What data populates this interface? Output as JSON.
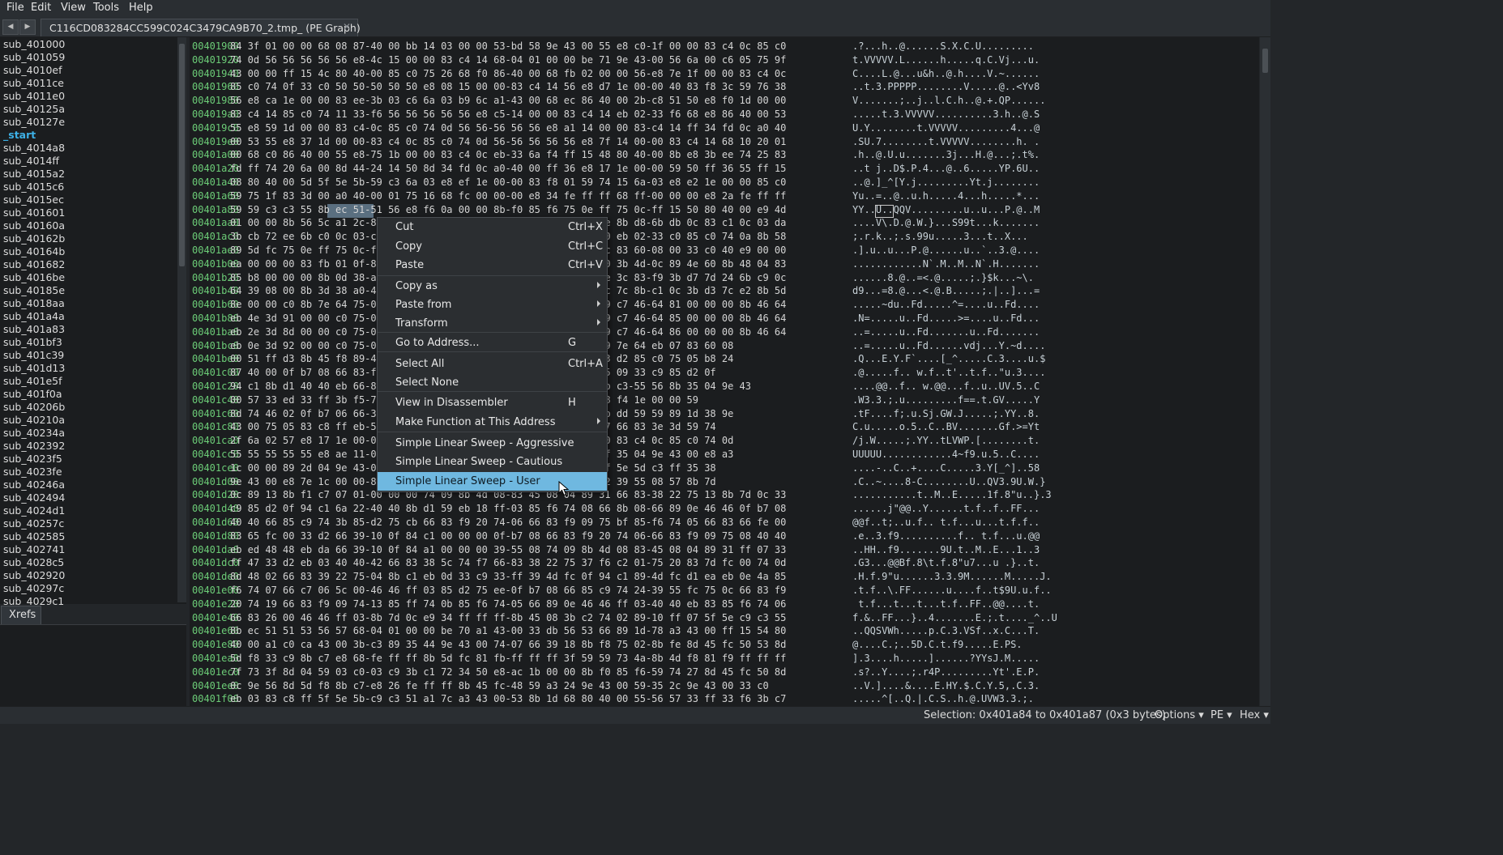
{
  "menubar": [
    "File",
    "Edit",
    "View",
    "Tools",
    "Help"
  ],
  "tab": {
    "title": "C116CD083284CC599C024C3479CA9B70_2.tmp_ (PE Graph)",
    "close": "✕"
  },
  "functions": [
    "sub_401000",
    "sub_401059",
    "sub_4010ef",
    "sub_4011ce",
    "sub_4011e0",
    "sub_40125a",
    "sub_40127e",
    "_start",
    "sub_4014a8",
    "sub_4014ff",
    "sub_4015a2",
    "sub_4015c6",
    "sub_4015ec",
    "sub_401601",
    "sub_40160a",
    "sub_40162b",
    "sub_40164b",
    "sub_401682",
    "sub_4016be",
    "sub_40185e",
    "sub_4018aa",
    "sub_401a4a",
    "sub_401a83",
    "sub_401bf3",
    "sub_401c39",
    "sub_401d13",
    "sub_401e5f",
    "sub_401f0a",
    "sub_40206b",
    "sub_40210a",
    "sub_40234a",
    "sub_402392",
    "sub_4023f5",
    "sub_4023fe",
    "sub_40246a",
    "sub_402494",
    "sub_4024d1",
    "sub_40257c",
    "sub_402585",
    "sub_402741",
    "sub_4028c5",
    "sub_402920",
    "sub_40297c",
    "sub_4029c1"
  ],
  "selected_function": "_start",
  "xrefs_tab": "Xrefs",
  "hex_rows": [
    {
      "addr": "00401900",
      "bytes": "84 3f 01 00 00 68 08 87-40 00 bb 14 03 00 00 53-bd 58 9e 43 00 55 e8 c0-1f 00 00 83 c4 0c 85 c0",
      "ascii": ".?...h..@......S.X.C.U........."
    },
    {
      "addr": "00401920",
      "bytes": "74 0d 56 56 56 56 56 e8-4c 15 00 00 83 c4 14 68-04 01 00 00 be 71 9e 43-00 56 6a 00 c6 05 75 9f",
      "ascii": "t.VVVVV.L......h.....q.C.Vj...u."
    },
    {
      "addr": "00401940",
      "bytes": "43 00 00 ff 15 4c 80 40-00 85 c0 75 26 68 f0 86-40 00 68 fb 02 00 00 56-e8 7e 1f 00 00 83 c4 0c",
      "ascii": "C....L.@...u&h..@.h....V.~......"
    },
    {
      "addr": "00401960",
      "bytes": "85 c0 74 0f 33 c0 50 50-50 50 50 e8 08 15 00 00-83 c4 14 56 e8 d7 1e 00-00 40 83 f8 3c 59 76 38",
      "ascii": "..t.3.PPPPP........V.....@..<Yv8"
    },
    {
      "addr": "00401980",
      "bytes": "56 e8 ca 1e 00 00 83 ee-3b 03 c6 6a 03 b9 6c a1-43 00 68 ec 86 40 00 2b-c8 51 50 e8 f0 1d 00 00",
      "ascii": "V.......;..j..l.C.h..@.+.QP......"
    },
    {
      "addr": "004019a0",
      "bytes": "83 c4 14 85 c0 74 11 33-f6 56 56 56 56 56 e8 c5-14 00 00 83 c4 14 eb 02-33 f6 68 e8 86 40 00 53",
      "ascii": ".....t.3.VVVVV..........3.h..@.S"
    },
    {
      "addr": "004019c0",
      "bytes": "55 e8 59 1d 00 00 83 c4-0c 85 c0 74 0d 56 56-56 56 56 e8 a1 14 00 00 83-c4 14 ff 34 fd 0c a0 40",
      "ascii": "U.Y........t.VVVVV.........4...@"
    },
    {
      "addr": "004019e0",
      "bytes": "00 53 55 e8 37 1d 00 00-83 c4 0c 85 c0 74 0d 56-56 56 56 56 e8 7f 14 00-00 83 c4 14 68 10 20 01",
      "ascii": ".SU.7........t.VVVVV........h. ."
    },
    {
      "addr": "00401a00",
      "bytes": "00 68 c0 86 40 00 55 e8-75 1b 00 00 83 c4 0c eb-33 6a f4 ff 15 48 80 40-00 8b e8 3b ee 74 25 83",
      "ascii": ".h..@.U.u.......3j...H.@...;.t%."
    },
    {
      "addr": "00401a20",
      "bytes": "fd ff 74 20 6a 00 8d 44-24 14 50 8d 34 fd 0c a0-40 00 ff 36 e8 17 1e 00-00 59 50 ff 36 55 ff 15",
      "ascii": "..t j..D$.P.4...@..6.....YP.6U.."
    },
    {
      "addr": "00401a40",
      "bytes": "08 80 40 00 5d 5f 5e 5b-59 c3 6a 03 e8 ef 1e 00-00 83 f8 01 59 74 15 6a-03 e8 e2 1e 00 00 85 c0",
      "ascii": "..@.]_^[Y.j.........Yt.j........"
    },
    {
      "addr": "00401a60",
      "bytes": "59 75 1f 83 3d 00 a0 40-00 01 75 16 68 fc 00 00-00 e8 34 fe ff ff 68 ff-00 00 00 e8 2a fe ff ff",
      "ascii": "Yu..=..@..u.h.....4...h.....*..."
    },
    {
      "addr": "00401a80",
      "bytes": "59 59 c3 c3 55 8b ec 51-51 56 e8 f6 0a 00 00 8b-f0 85 f6 75 0e ff 75 0c-ff 15 50 80 40 00 e9 4d",
      "ascii": "YY..U..QQV.........u..u...P.@..M"
    },
    {
      "addr": "00401aa0",
      "bytes": "01 00 00 8b 56 5c a1 2c-80 40 00 8b ce 39 01 74-0e 8b d8 39 74 0e 8b d8-6b db 0c 83 c1 0c 03 da",
      "ascii": "....V\\.D.@.W.}...S99t...k......."
    },
    {
      "addr": "00401ac0",
      "bytes": "3b cb 72 ee 6b c0 0c 03-c1 3b c8 73 39 39 75 00-00 75 01 00 75 00 eb 02-33 c0 85 c0 74 0a 8b 58",
      "ascii": ";.r.k..;.s.99u.....3...t..X..."
    },
    {
      "addr": "00401ae0",
      "bytes": "89 5d fc 75 0e ff 75 0c-ff 15 50 80 40 00 ff 75-0c 83 fb 05 75 0c 83 60-08 00 33 c0 40 e9 00 00",
      "ascii": ".].u..u...P.@......u..`..3.@...."
    },
    {
      "addr": "00401b00",
      "bytes": "ea 00 00 00 83 fb 01 0f-84 4e 00 83 4d 00 4e 60-4d 00 60 00 4d 00 3b 4d-0c 89 4e 60 8b 48 04 83",
      "ascii": "............N`.M..M..N`.H......."
    },
    {
      "addr": "00401b20",
      "bytes": "85 b8 00 00 00 8b 0d 38-a0 40 00 89 4d 3c 8b 3d-3c a0 40 00 3b 4e 3c 83-f9 3b d7 7d 24 6b c9 0c",
      "ascii": "......8.@..=<.@.....;.}$k...~\\."
    },
    {
      "addr": "00401b40",
      "bytes": "64 39 08 00 8b 3d 38 a0-40 00 8b 3d 3c 3c 40 00-3c 40 00 8b 7c 7c 7c 8b-c1 0c 3b d3 7c e2 8b 5d",
      "ascii": "d9...=8.@...<.@.B.....;.|..]...="
    },
    {
      "addr": "00401b60",
      "bytes": "8e 00 00 c0 8b 7e 64 75-06 8b 46 64 8b 46 5e 00-00 00 00 c0 75 09 c7 46-64 81 00 00 00 8b 46 64",
      "ascii": ".....~du..Fd.....^=....u..Fd...."
    },
    {
      "addr": "00401b80",
      "bytes": "eb 4e 3d 91 00 00 c0 75-09 c7 46 64 84 00 00 00-00 00 00 c0 75 09 c7 46-64 85 00 00 00 8b 46 64",
      "ascii": ".N=.....u..Fd.....>=....u..Fd..."
    },
    {
      "addr": "00401ba0",
      "bytes": "eb 2e 3d 8d 00 00 c0 75-09 c7 46 64 82 00 00 00-8f 00 00 c0 75 09 c7 46-64 86 00 00 00 8b 46 64",
      "ascii": "..=.....u..Fd.......u..Fd......."
    },
    {
      "addr": "00401bc0",
      "bytes": "eb 0e 3d 92 00 00 c0 75-09 c7 46 64 8a 00 00 00-0a 08 ff d3 59-89 7e 64 eb 07 83 60 08",
      "ascii": "..=.....u..Fd......vdj...Y.~d...."
    },
    {
      "addr": "00401be0",
      "bytes": "00 51 ff d3 8b 45 f8 89-46 60 e9 07 ff ff ff 8b-c0 c0 ca 43 00-33 d2 85 c0 75 05 b8 24",
      "ascii": ".Q...E.Y.F`....[_^.....C.3....u.$"
    },
    {
      "addr": "00401c00",
      "bytes": "87 40 00 0f b7 08 66 83-f9 20 74 0b 66 85 c9 74-1b 66 83 f9-22 75 09 33 c9 85 d2 0f",
      "ascii": ".@.....f.. w.f..t'..t.f..\"u.3...."
    },
    {
      "addr": "00401c20",
      "bytes": "94 c1 8b d1 40 40 eb 66-83 f9 20 74 0a 66 85 c9-66 85 c9 75 0f 8b c3-55 56 8b 35 04 9e 43",
      "ascii": "....@@..f.. w.@@...f..u..UV.5..C"
    },
    {
      "addr": "00401c40",
      "bytes": "00 57 33 ed 33 ff 3b f5-75 07 66 ad 3d 20-3d 3d 00 74 01-47 56 e8 f4 1e 00 00 59",
      "ascii": ".W3.3.;.u.........f==.t.GV.....Y"
    },
    {
      "addr": "00401c60",
      "bytes": "8d 74 46 02 0f b7 06 66-3b c5 75 e5 53 6a 04 47-1e 00 00 8b d8-3b dd 59 59 89 1d 38 9e",
      "ascii": ".tF....f;.u.Sj.GW.J.....;.YY..8."
    },
    {
      "addr": "00401c80",
      "bytes": "43 00 75 05 83 c8 ff eb-5f 8b 2d 04 9e 43 00 eb-1e 00 00 8b-f8 47 66 83 3e 3d 59 74",
      "ascii": "C.u.....o.5..C..BV.......Gf.>=Yt"
    },
    {
      "addr": "00401ca0",
      "bytes": "2f 6a 02 57 e8 17 1e 00-00 59 59 89 03 85 c0 74-50 e8 5b 1d 00-00 83 c4 0c 85 c0 74 0d",
      "ascii": "/j.W.....;.YY..tLVWP.[........t."
    },
    {
      "addr": "00401cc0",
      "bytes": "55 55 55 55 55 e8 ae 11-00 00 83 c4 14 83 c3 04-66 39 2e 75 b9-ff 35 04 9e 43 00 e8 a3",
      "ascii": "UUUUU............4~f9.u.5..C...."
    },
    {
      "addr": "00401ce0",
      "bytes": "1c 00 00 89 2d 04 9e 43-00 89 2b c7 05 28 9e 43-00 33 c0 59-5b 5f 5e 5d c3 ff 35 38",
      "ascii": "....-..C..+....C.....3.Y[_^]..58"
    },
    {
      "addr": "00401d00",
      "bytes": "9e 43 00 e8 7e 1c 00 00-83 25 38 9e 43 00 00 83-c8 ec 51 56-33 d2 39 55 08 57 8b 7d",
      "ascii": ".C..~....8-C........U..QV3.9U.W.}"
    },
    {
      "addr": "00401d20",
      "bytes": "0c 89 13 8b f1 c7 07 01-00 00 00 74 09 8b 4d 08-83 45 08 04 89 31 66 83-38 22 75 13 8b 7d 0c 33",
      "ascii": "...........t..M..E.....1f.8\"u..}.3"
    },
    {
      "addr": "00401d40",
      "bytes": "c9 85 d2 0f 94 c1 6a 22-40 40 8b d1 59 eb 18 ff-03 85 f6 74 08 66 8b 08-66 89 0e 46 46 0f b7 08",
      "ascii": "......j\"@@..Y......t.f..f..FF..."
    },
    {
      "addr": "00401d60",
      "bytes": "40 40 66 85 c9 74 3b 85-d2 75 cb 66 83 f9 20 74-06 66 83 f9 09 75 bf 85-f6 74 05 66 83 66 fe 00",
      "ascii": "@@f..t;..u.f.. t.f...u...t.f.f.."
    },
    {
      "addr": "00401d80",
      "bytes": "83 65 fc 00 33 d2 66 39-10 0f 84 c1 00 00 00 0f-b7 08 66 83 f9 20 74 06-66 83 f9 09 75 08 40 40",
      "ascii": ".e..3.f9..........f.. t.f...u.@@"
    },
    {
      "addr": "00401da0",
      "bytes": "eb ed 48 48 eb da 66 39-10 0f 84 a1 00 00 00 39-55 08 74 09 8b 4d 08 83-45 08 04 89 31 ff 07 33",
      "ascii": "..HH..f9.......9U.t..M..E...1..3"
    },
    {
      "addr": "00401dc0",
      "bytes": "ff 47 33 d2 eb 03 40 40-42 66 83 38 5c 74 f7 66-83 38 22 75 37 f6 c2 01-75 20 83 7d fc 00 74 0d",
      "ascii": ".G3...@@Bf.8\\t.f.8\"u7...u .}..t."
    },
    {
      "addr": "00401de0",
      "bytes": "8d 48 02 66 83 39 22 75-04 8b c1 eb 0d 33 c9 33-ff 39 4d fc 0f 94 c1 89-4d fc d1 ea eb 0e 4a 85",
      "ascii": ".H.f.9\"u......3.3.9M......M.....J."
    },
    {
      "addr": "00401e00",
      "bytes": "f6 74 07 66 c7 06 5c 00-46 46 ff 03 85 d2 75 ee-0f b7 08 66 85 c9 74 24-39 55 fc 75 0c 66 83 f9",
      "ascii": ".t.f..\\.FF......u....f..t$9U.u.f.."
    },
    {
      "addr": "00401e20",
      "bytes": "20 74 19 66 83 f9 09 74-13 85 ff 74 0b 85 f6 74-05 66 89 0e 46 46 ff 03-40 40 eb 83 85 f6 74 06",
      "ascii": " t.f...t...t...t.f..FF..@@....t."
    },
    {
      "addr": "00401e40",
      "bytes": "66 83 26 00 46 46 ff 03-8b 7d 0c e9 34 ff ff ff-8b 45 08 3b c2 74 02 89-10 ff 07 5f 5e c9 c3 55",
      "ascii": "f.&..FF...}..4.......E.;.t...._^..U"
    },
    {
      "addr": "00401e60",
      "bytes": "8b ec 51 51 53 56 57 68-04 01 00 00 be 70 a1 43-00 33 db 56 53 66 89 1d-78 a3 43 00 ff 15 54 80",
      "ascii": "..QQSVWh.....p.C.3.VSf..x.C...T."
    },
    {
      "addr": "00401e80",
      "bytes": "40 00 a1 c0 ca 43 00 3b-c3 89 35 44 9e 43 00 74-07 66 39 18 8b f8 75 02-8b fe 8d 45 fc 50 53 8d",
      "ascii": "@....C.;..5D.C.t.f9.....E.PS."
    },
    {
      "addr": "00401ea0",
      "bytes": "5d f8 33 c9 8b c7 e8 68-fe ff ff 8b 5d fc 81 fb-ff ff ff 3f 59 59 73 4a-8b 4d f8 81 f9 ff ff ff",
      "ascii": "].3....h.....]......?YYsJ.M....."
    },
    {
      "addr": "00401ec0",
      "bytes": "7f 73 3f 8d 04 59 03 c0-03 c9 3b c1 72 34 50 e8-ac 1b 00 00 8b f0 85 f6-59 74 27 8d 45 fc 50 8d",
      "ascii": ".s?..Y....;.r4P.........Yt'.E.P."
    },
    {
      "addr": "00401ee0",
      "bytes": "0c 9e 56 8d 5d f8 8b c7-e8 26 fe ff ff 8b 45 fc-48 59 a3 24 9e 43 00 59-35 2c 9e 43 00 33 c0",
      "ascii": "..V.]....&....E.HY.$.C.Y.5,.C.3."
    },
    {
      "addr": "00401f00",
      "bytes": "eb 03 83 c8 ff 5f 5e 5b-c9 c3 51 a1 7c a3 43 00-53 8b 1d 68 80 40 00 55-56 57 33 ff 33 f6 3b c7",
      "ascii": ".....^[..Q.|.C.S..h.@.UVW3.3.;."
    }
  ],
  "context_menu": [
    {
      "label": "Cut",
      "shortcut": "Ctrl+X"
    },
    {
      "label": "Copy",
      "shortcut": "Ctrl+C"
    },
    {
      "label": "Paste",
      "shortcut": "Ctrl+V"
    },
    {
      "label": "Copy as",
      "submenu": true
    },
    {
      "label": "Paste from",
      "submenu": true
    },
    {
      "label": "Transform",
      "submenu": true
    },
    {
      "label": "Go to Address...",
      "shortcut": "G"
    },
    {
      "label": "Select All",
      "shortcut": "Ctrl+A"
    },
    {
      "label": "Select None"
    },
    {
      "label": "View in Disassembler",
      "shortcut": "H"
    },
    {
      "label": "Make Function at This Address",
      "submenu": true
    },
    {
      "label": "Simple Linear Sweep - Aggressive"
    },
    {
      "label": "Simple Linear Sweep - Cautious"
    },
    {
      "label": "Simple Linear Sweep - User",
      "highlighted": true
    }
  ],
  "status": {
    "selection": "Selection: 0x401a84 to 0x401a87 (0x3 bytes)",
    "options": "Options ▾",
    "pe": "PE ▾",
    "hex": "Hex ▾"
  },
  "colors": {
    "address": "#6ccc77",
    "highlight": "#6fb8e0",
    "selection": "#5a6f80",
    "function_entry": "#3db0e6"
  }
}
